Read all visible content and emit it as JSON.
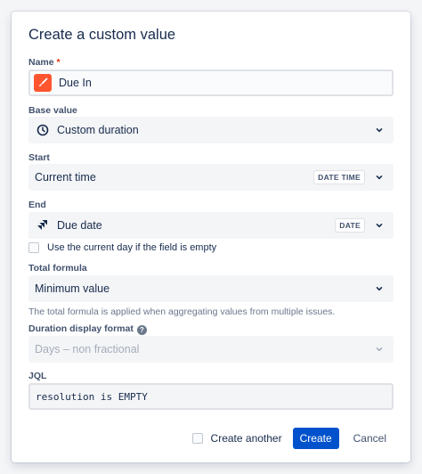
{
  "dialog": {
    "title": "Create a custom value"
  },
  "name": {
    "label": "Name",
    "required_marker": "*",
    "value": "Due In",
    "icon": "paintbrush-icon"
  },
  "base_value": {
    "label": "Base value",
    "value": "Custom duration",
    "icon": "clock-icon"
  },
  "start": {
    "label": "Start",
    "value": "Current time",
    "badge": "DATE TIME"
  },
  "end": {
    "label": "End",
    "value": "Due date",
    "badge": "DATE",
    "icon": "jira-icon",
    "checkbox_label": "Use the current day if the field is empty"
  },
  "total_formula": {
    "label": "Total formula",
    "value": "Minimum value",
    "helper": "The total formula is applied when aggregating values from multiple issues."
  },
  "duration_display": {
    "label": "Duration display format",
    "value": "Days – non fractional"
  },
  "jql": {
    "label": "JQL",
    "value": "resolution is EMPTY"
  },
  "footer": {
    "create_another_label": "Create another",
    "create_label": "Create",
    "cancel_label": "Cancel"
  },
  "colors": {
    "primary": "#0052cc",
    "name_icon_bg": "#ff5630",
    "required": "#de350b"
  }
}
